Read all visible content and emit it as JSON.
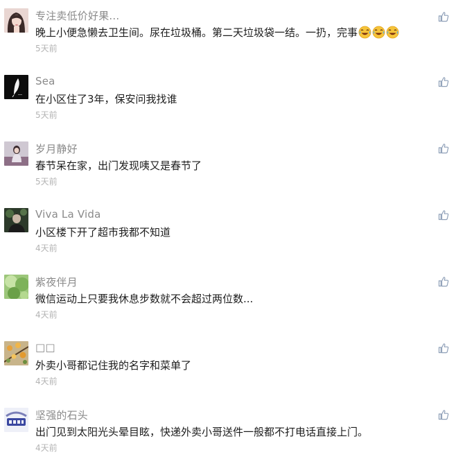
{
  "comments": [
    {
      "name": "专注卖低价好果...",
      "text": "晚上小便急懒去卫生间。尿在垃圾桶。第二天垃圾袋一结。一扔，完事",
      "time": "5天前",
      "avatar_icon": "girl-portrait-avatar",
      "emojis": [
        "laugh-cry-emoji",
        "laugh-cry-emoji",
        "laugh-cry-emoji"
      ]
    },
    {
      "name": "Sea",
      "text": "在小区住了3年，保安问我找谁",
      "time": "5天前",
      "avatar_icon": "feather-avatar"
    },
    {
      "name": "岁月静好",
      "text": "春节呆在家，出门发现咦又是春节了",
      "time": "5天前",
      "avatar_icon": "girl-sitting-avatar"
    },
    {
      "name": "Viva La Vida",
      "text": "小区楼下开了超市我都不知道",
      "time": "4天前",
      "avatar_icon": "dark-portrait-avatar"
    },
    {
      "name": "紫夜伴月",
      "text": "微信运动上只要我休息步数就不会超过两位数...",
      "time": "4天前",
      "avatar_icon": "green-nature-avatar"
    },
    {
      "name": "□□",
      "text": "外卖小哥都记住我的名字和菜单了",
      "time": "4天前",
      "avatar_icon": "flower-branch-avatar"
    },
    {
      "name": "坚强的石头",
      "text": "出门见到太阳光头晕目眩，快递外卖小哥送件一般都不打电话直接上门。",
      "time": "4天前",
      "avatar_icon": "logo-text-avatar"
    }
  ],
  "like_icon": "thumbs-up-icon",
  "colors": {
    "name": "#8a8a8a",
    "text": "#1d1d1d",
    "time": "#b4b4b4",
    "like": "#8fa0b8",
    "background": "#ffffff"
  }
}
